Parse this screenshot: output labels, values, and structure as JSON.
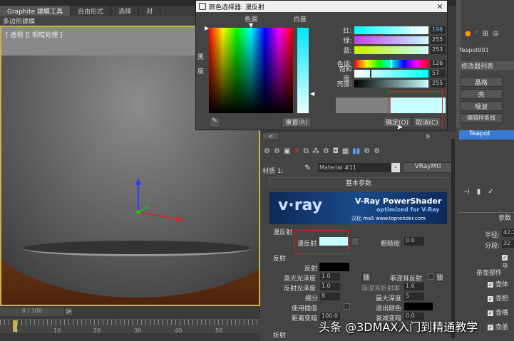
{
  "tabs": [
    "Graphite 建模工具",
    "自由形式",
    "选择",
    "对"
  ],
  "subtab": "多边形建模",
  "viewport": {
    "label": "[ 透视 ][ 明暗处理 ]"
  },
  "timeline": {
    "frame": "0 / 100",
    "next": ">",
    "ticks": [
      "0",
      "10",
      "20",
      "30",
      "40",
      "50"
    ]
  },
  "dialog": {
    "title": "颜色选择器: 漫反射",
    "hue_label": "色调",
    "whiteness_label": "白度",
    "blackness_label": "黑\n度",
    "rows": [
      {
        "label": "红:",
        "value": "198",
        "fraction": 0.776
      },
      {
        "label": "绿:",
        "value": "255",
        "fraction": 1.0
      },
      {
        "label": "蓝:",
        "value": "253",
        "fraction": 0.992
      },
      {
        "label": "色调:",
        "value": "126",
        "fraction": 0.494
      },
      {
        "label": "饱和度:",
        "value": "57",
        "fraction": 0.224
      },
      {
        "label": "亮度:",
        "value": "255",
        "fraction": 1.0
      }
    ],
    "reset": "重置(R)",
    "ok": "确定(O)",
    "cancel": "取消(C)",
    "old_color": "#808080",
    "new_color": "#c6fffd"
  },
  "material": {
    "label": "材质 1:",
    "name": "Material #11",
    "type": "VRayMtl",
    "rollout": "基本参数",
    "banner": {
      "logo": "v·ray",
      "title": "V-Ray PowerShader",
      "subtitle": "optimized for V-Ray",
      "credit": "汉化 ma5 www.toprender.com"
    },
    "diffuse_group": "漫反射",
    "diffuse_label": "漫反射",
    "diffuse_color": "#c6fffd",
    "roughness_label": "粗糙度",
    "roughness": "0.0",
    "reflect_group": "反射",
    "reflect_label": "反射",
    "hilight_label": "高光光泽度",
    "hilight": "1.0",
    "lock": "锁",
    "fresnel_label": "菲涅耳反射",
    "fresnel_lock": "锁",
    "refl_gloss_label": "反射光泽度",
    "refl_gloss": "1.0",
    "fresnel_ior_label": "菲涅耳折射率",
    "fresnel_ior": "1.6",
    "subdivs_label": "细分",
    "subdivs": "8",
    "max_depth_label": "最大深度",
    "max_depth": "5",
    "interp_label": "使用插值",
    "exit_label": "退出颜色",
    "dim_label": "距离变暗",
    "dim": "100.0",
    "dim_fall_label": "衰减变暗",
    "dim_fall": "0.0",
    "refract_group": "折射"
  },
  "command": {
    "object": "Teapot001",
    "modlist": "修改器列表",
    "buttons": [
      "晶格",
      "壳",
      "噪波",
      "编辑样条线"
    ],
    "stack": "Teapot",
    "params": "参数",
    "radius_label": "半径:",
    "radius": "42.2",
    "segs_label": "分段:",
    "segs": "32",
    "smooth": "平",
    "parts": "茶壶部件",
    "checks": [
      "壶体",
      "壶把",
      "壶嘴",
      "壶盖"
    ]
  },
  "watermark": "头条 @3DMAX入门到精通教学"
}
